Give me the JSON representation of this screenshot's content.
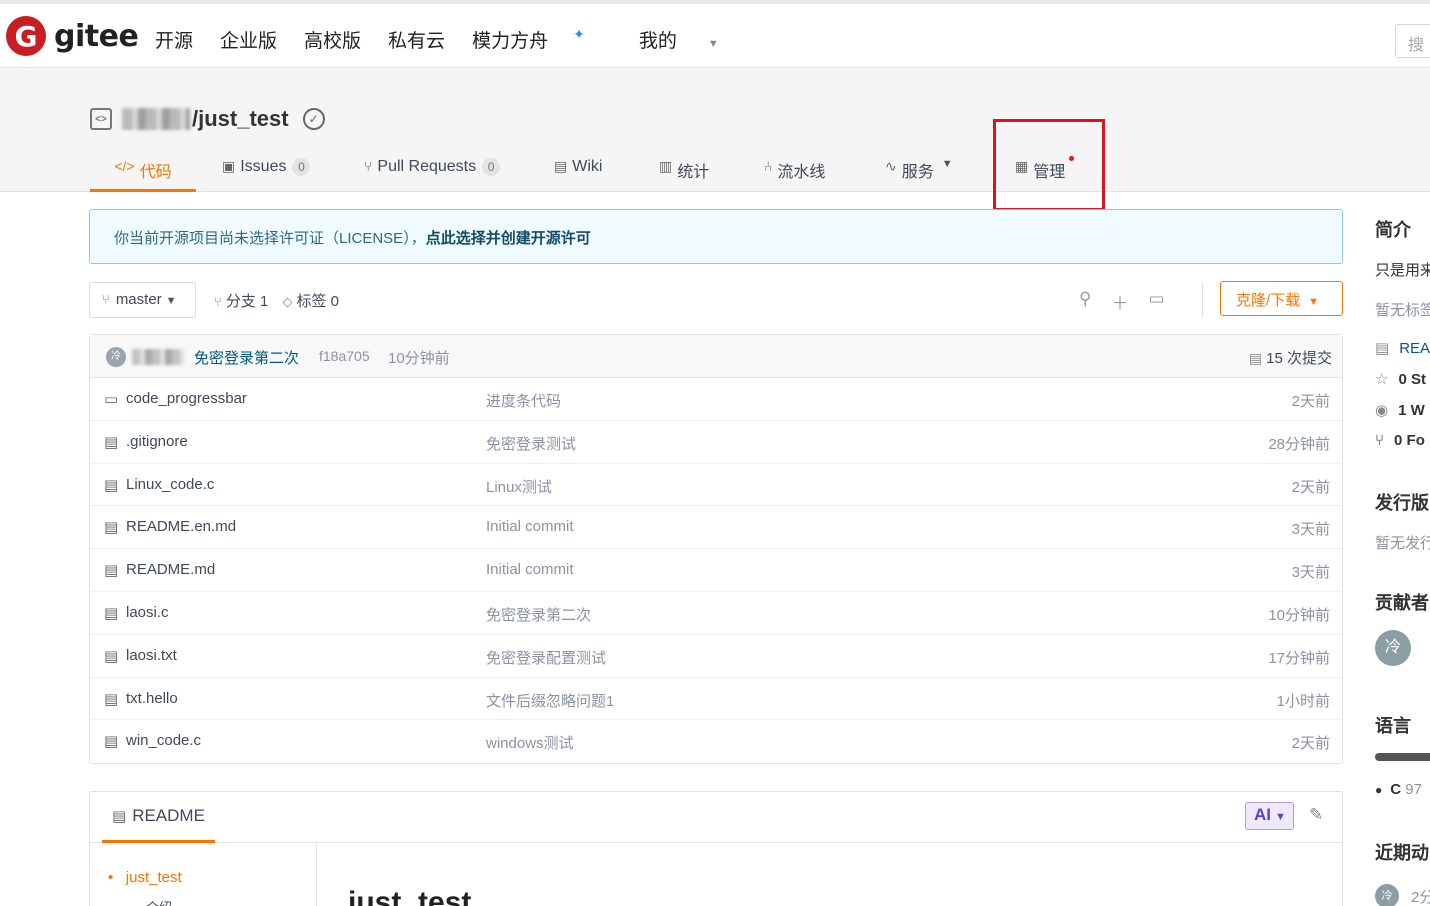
{
  "nav": {
    "logo_mark": "G",
    "logo_text": "gitee",
    "items": [
      "开源",
      "企业版",
      "高校版",
      "私有云",
      "模力方舟",
      "我的"
    ],
    "search_placeholder": "搜"
  },
  "repo": {
    "name": "/just_test",
    "tabs": [
      {
        "label": "代码",
        "icon": "</>"
      },
      {
        "label": "Issues",
        "count": "0"
      },
      {
        "label": "Pull Requests",
        "count": "0"
      },
      {
        "label": "Wiki"
      },
      {
        "label": "统计"
      },
      {
        "label": "流水线"
      },
      {
        "label": "服务"
      },
      {
        "label": "管理"
      }
    ]
  },
  "notice": {
    "text": "你当前开源项目尚未选择许可证（LICENSE），",
    "link": "点此选择并创建开源许可"
  },
  "branch": {
    "current": "master",
    "branches": "分支 1",
    "tags": "标签 0",
    "clone_label": "克隆/下载"
  },
  "commit": {
    "message": "免密登录第二次",
    "hash": "f18a705",
    "time": "10分钟前",
    "count_label": "15 次提交"
  },
  "files": [
    {
      "type": "folder",
      "name": "code_progressbar",
      "message": "进度条代码",
      "time": "2天前"
    },
    {
      "type": "file",
      "name": ".gitignore",
      "message": "免密登录测试",
      "time": "28分钟前"
    },
    {
      "type": "file",
      "name": "Linux_code.c",
      "message": "Linux测试",
      "time": "2天前"
    },
    {
      "type": "file",
      "name": "README.en.md",
      "message": "Initial commit",
      "time": "3天前"
    },
    {
      "type": "file",
      "name": "README.md",
      "message": "Initial commit",
      "time": "3天前"
    },
    {
      "type": "file",
      "name": "laosi.c",
      "message": "免密登录第二次",
      "time": "10分钟前"
    },
    {
      "type": "file",
      "name": "laosi.txt",
      "message": "免密登录配置测试",
      "time": "17分钟前"
    },
    {
      "type": "file",
      "name": "txt.hello",
      "message": "文件后缀忽略问题1",
      "time": "1小时前"
    },
    {
      "type": "file",
      "name": "win_code.c",
      "message": "windows测试",
      "time": "2天前"
    }
  ],
  "readme": {
    "tab_label": "README",
    "ai_label": "AI",
    "toc_item": "just_test",
    "toc_sub": "介绍",
    "heading": "just_test"
  },
  "sidebar": {
    "intro_title": "简介",
    "intro_text": "只是用来",
    "no_tags": "暂无标签",
    "readme_link": "REA",
    "stars": "0 St",
    "watches": "1 W",
    "forks": "0 Fo",
    "release_title": "发行版",
    "no_release": "暂无发行",
    "contributors_title": "贡献者",
    "contributor_avatar": "冷",
    "lang_title": "语言",
    "lang_c": "C",
    "lang_c_pct": "97",
    "activity_title": "近期动",
    "activity_time": "2分"
  }
}
